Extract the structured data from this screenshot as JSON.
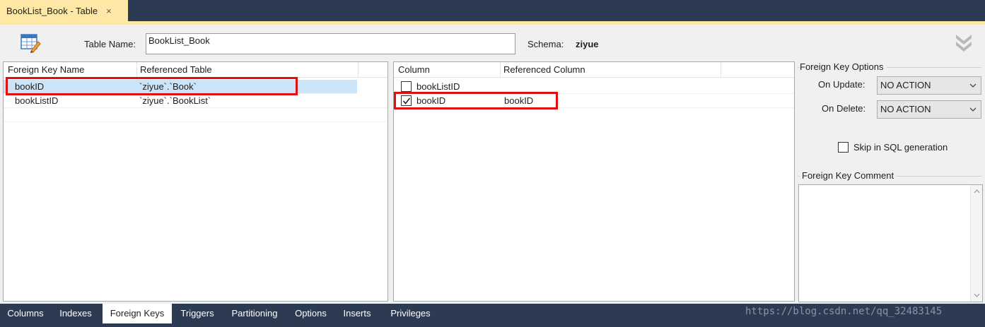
{
  "document_tab": {
    "label": "BookList_Book - Table",
    "close_glyph": "×"
  },
  "header": {
    "table_name_label": "Table Name:",
    "table_name_value": "BookList_Book",
    "schema_label": "Schema:",
    "schema_value": "ziyue"
  },
  "foreign_keys_grid": {
    "columns": [
      "Foreign Key Name",
      "Referenced Table"
    ],
    "rows": [
      {
        "name": "bookID",
        "table": "`ziyue`.`Book`",
        "selected": true
      },
      {
        "name": "bookListID",
        "table": "`ziyue`.`BookList`",
        "selected": false
      }
    ]
  },
  "columns_grid": {
    "columns": [
      "Column",
      "Referenced Column"
    ],
    "rows": [
      {
        "column": "bookListID",
        "referenced": "",
        "checked": false
      },
      {
        "column": "bookID",
        "referenced": "bookID",
        "checked": true
      }
    ]
  },
  "options": {
    "group_title": "Foreign Key Options",
    "on_update_label": "On Update:",
    "on_update_value": "NO ACTION",
    "on_delete_label": "On Delete:",
    "on_delete_value": "NO ACTION",
    "skip_sql_label": "Skip in SQL generation",
    "skip_sql_checked": false,
    "comment_title": "Foreign Key Comment",
    "comment_value": ""
  },
  "bottom_tabs": [
    {
      "label": "Columns",
      "active": false
    },
    {
      "label": "Indexes",
      "active": false
    },
    {
      "label": "Foreign Keys",
      "active": true
    },
    {
      "label": "Triggers",
      "active": false
    },
    {
      "label": "Partitioning",
      "active": false
    },
    {
      "label": "Options",
      "active": false
    },
    {
      "label": "Inserts",
      "active": false
    },
    {
      "label": "Privileges",
      "active": false
    }
  ],
  "watermark": "https://blog.csdn.net/qq_32483145",
  "colors": {
    "chrome_dark": "#2c3a52",
    "tab_accent": "#ffe8a6",
    "selection": "#cce4f7",
    "highlight_annotation": "#e01010"
  },
  "icons": [
    "table-editor-icon",
    "collapse-chevrons-icon",
    "close-icon",
    "checkbox-icon",
    "dropdown-arrow-icon"
  ]
}
